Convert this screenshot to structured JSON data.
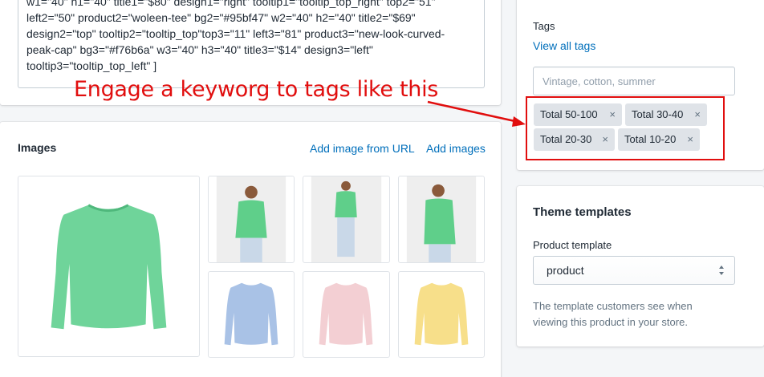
{
  "description": {
    "text": "w1=\"40\" h1=\"40\" title1=\"$80\" design1=\"right\" tooltip1=\"tooltip_top_right\" top2=\"51\"\nleft2=\"50\" product2=\"woleen-tee\" bg2=\"#95bf47\" w2=\"40\" h2=\"40\" title2=\"$69\"\ndesign2=\"top\" tooltip2=\"tooltip_top\"top3=\"11\" left3=\"81\" product3=\"new-look-curved-\npeak-cap\" bg3=\"#f76b6a\" w3=\"40\" h3=\"40\" title3=\"$14\" design3=\"left\"\ntooltip3=\"tooltip_top_left\" ]"
  },
  "images": {
    "title": "Images",
    "add_from_url": "Add image from URL",
    "add_images": "Add images",
    "items": [
      {
        "name": "green sweater",
        "color": "#6fd49a"
      },
      {
        "name": "model green sweater",
        "color": "#5fcf8a"
      },
      {
        "name": "model green sweater full",
        "color": "#5fcf8a"
      },
      {
        "name": "model green sweater side",
        "color": "#5fcf8a"
      },
      {
        "name": "blue sweater",
        "color": "#a9c2e6"
      },
      {
        "name": "pink sweater",
        "color": "#f3cfd3"
      },
      {
        "name": "yellow sweater",
        "color": "#f7df8a"
      }
    ]
  },
  "tags": {
    "label": "Tags",
    "view_all": "View all tags",
    "placeholder": "Vintage, cotton, summer",
    "items": [
      "Total 50-100",
      "Total 30-40",
      "Total 20-30",
      "Total 10-20"
    ],
    "remove_glyph": "×"
  },
  "theme": {
    "title": "Theme templates",
    "product_template_label": "Product template",
    "selected": "product",
    "help": "The template customers see when viewing this product in your store."
  },
  "annotation": {
    "text": "Engage a keyworg to tags like this",
    "color": "#e10e0e"
  }
}
